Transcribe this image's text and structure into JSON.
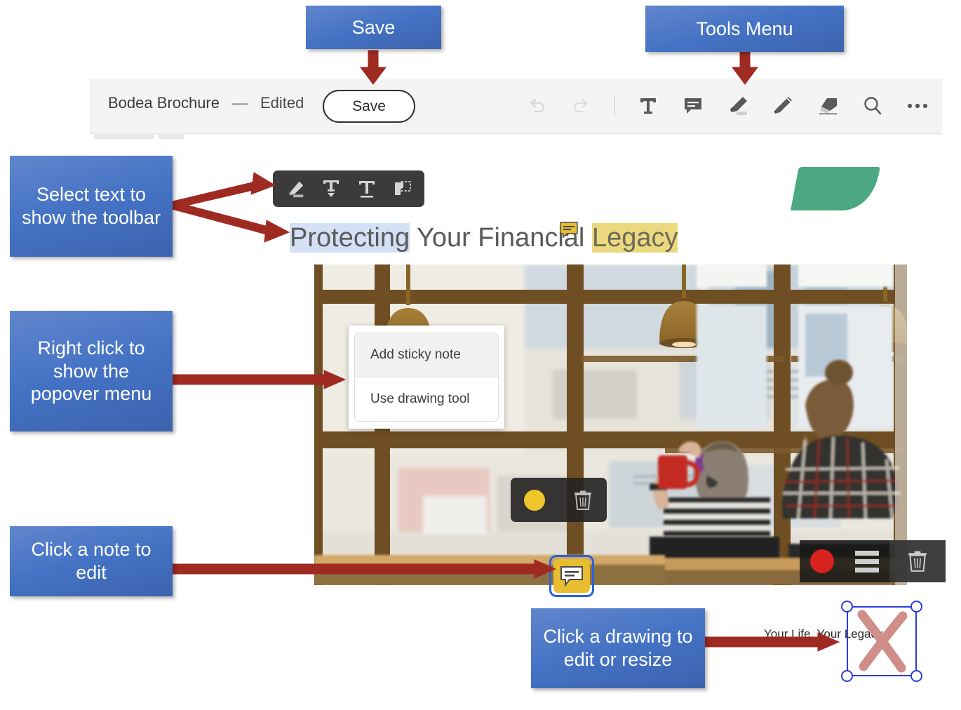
{
  "app": {
    "document_title": "Bodea Brochure",
    "separator": "—",
    "status": "Edited",
    "save_label": "Save",
    "toolbar_icons": [
      {
        "name": "undo-icon",
        "label": "Undo",
        "state": "disabled"
      },
      {
        "name": "redo-icon",
        "label": "Redo",
        "state": "disabled"
      },
      {
        "name": "add-text-icon",
        "label": "Add text"
      },
      {
        "name": "sticky-note-icon",
        "label": "Add comment"
      },
      {
        "name": "highlighter-icon",
        "label": "Highlight"
      },
      {
        "name": "pencil-icon",
        "label": "Draw"
      },
      {
        "name": "eraser-icon",
        "label": "Erase"
      },
      {
        "name": "search-icon",
        "label": "Search"
      },
      {
        "name": "more-options-icon",
        "label": "More"
      }
    ]
  },
  "text_toolbar": {
    "items": [
      {
        "name": "highlight-icon",
        "label": "Highlight text"
      },
      {
        "name": "strikethrough-icon",
        "label": "Strikethrough"
      },
      {
        "name": "underline-icon",
        "label": "Underline"
      },
      {
        "name": "copy-icon",
        "label": "Copy"
      }
    ]
  },
  "document": {
    "headline_part_selected": "Protecting",
    "headline_part_plain": " Your Financial ",
    "headline_part_highlighted": "Legacy",
    "footer_text": "Your Life, Your Legacy"
  },
  "popover": {
    "items": [
      {
        "label": "Add sticky note"
      },
      {
        "label": "Use drawing tool"
      }
    ]
  },
  "note_toolbar": {
    "color": "#efc62c",
    "color_label": "Note color",
    "delete_label": "Delete note"
  },
  "draw_toolbar": {
    "color": "#d8221d",
    "color_label": "Drawing color",
    "thickness_label": "Stroke thickness",
    "delete_label": "Delete drawing"
  },
  "callouts": [
    {
      "id": "save",
      "text": "Save"
    },
    {
      "id": "tools-menu",
      "text": "Tools Menu"
    },
    {
      "id": "select-text",
      "text": "Select text to show the toolbar"
    },
    {
      "id": "right-click",
      "text": "Right click to show the popover menu"
    },
    {
      "id": "click-note",
      "text": "Click a note to edit"
    },
    {
      "id": "click-drawing",
      "text": "Click a drawing to edit or resize"
    }
  ],
  "colors": {
    "callout_blue": "#4472c4",
    "arrow_red": "#9e2a22",
    "accent_green": "#4ca882",
    "selection_blue": "#d3e0f5",
    "highlight_yellow": "#ecd97e",
    "note_yellow": "#e8bd32",
    "drawing_pink": "#cf8e88",
    "handle_blue": "#2a3fd6"
  }
}
